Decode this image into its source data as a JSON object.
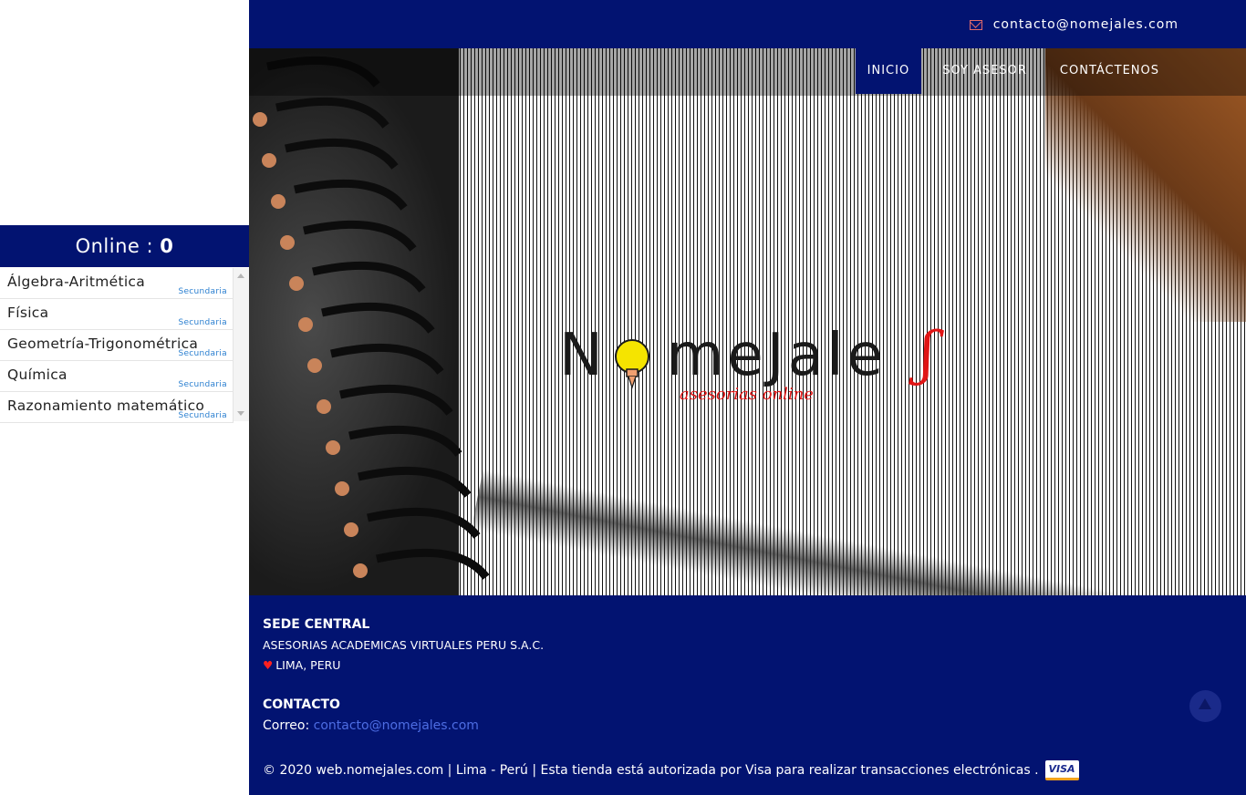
{
  "topbar": {
    "email": "contacto@nomejales.com",
    "icon": "envelope-icon"
  },
  "nav": {
    "items": [
      "INICIO",
      "SOY ASESOR",
      "CONTÁCTENOS"
    ],
    "active": "INICIO"
  },
  "sidebar": {
    "online_label": "Online :",
    "online_count": "0",
    "courses": [
      {
        "name": "Álgebra-Aritmética",
        "level": "Secundaria"
      },
      {
        "name": "Física",
        "level": "Secundaria"
      },
      {
        "name": "Geometría-Trigonométrica",
        "level": "Secundaria"
      },
      {
        "name": "Química",
        "level": "Secundaria"
      },
      {
        "name": "Razonamiento matemático",
        "level": "Secundaria"
      }
    ]
  },
  "hero": {
    "logo_text": "NomeJales",
    "logo_tagline": "asesorias online"
  },
  "footer": {
    "sede_title": "SEDE CENTRAL",
    "company": "ASESORIAS ACADEMICAS VIRTUALES PERU S.A.C.",
    "location": "LIMA, PERU",
    "contact_title": "CONTACTO",
    "correo_label": "Correo:",
    "correo_value": "contacto@nomejales.com",
    "copyright": "© 2020 web.nomejales.com | Lima - Perú | Esta tienda está autorizada por Visa para realizar transacciones electrónicas .",
    "visa_label": "VISA"
  },
  "colors": {
    "navy": "#021371",
    "link": "#4d6de3",
    "heart": "#ff2020",
    "logo_red": "#e01515"
  }
}
